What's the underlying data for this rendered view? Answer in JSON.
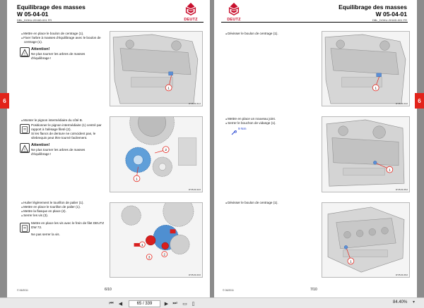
{
  "left_page": {
    "title": "Equilibrage des masses",
    "code": "W 05-04-01",
    "doc_ref": "DBL_DOKU-2016D-001 FR",
    "logo": "DEUTZ",
    "tab": "6",
    "step1": {
      "bullets": [
        "Mettre en place le boulon de centrage (1).",
        "Fixer l'arbre à masses d'équilibrage avec le boulon de centrage (1)."
      ],
      "attention_title": "Attention!",
      "attention_text": "Ne plus tourner les arbres de masses d'équilibrage !",
      "img_ref": "W 05-04-31-0"
    },
    "step2": {
      "bullets": [
        "Monter le pignon intermédiaire du côté B."
      ],
      "sub1": "Positionner le pignon intermédiaire (1) centré par rapport à l'alésage fileté (2).",
      "sub2": "Si les flancs de denture ne coïncident pas, le vilebrequin peut être tourné facilement.",
      "attention_title": "Attention!",
      "attention_text": "Ne plus tourner les arbres de masses d'équilibrage !",
      "img_ref": "W 05-04-32-0"
    },
    "step3": {
      "bullets": [
        "Huiler légèrement le tourillon de palier (1).",
        "Mettre en place le tourillon de palier (1).",
        "Mettre la flasque en place (2).",
        "Serrer les vis (3)."
      ],
      "sub1": "Mettre en place les vis avec le frein de filet DEUTZ DW 72.",
      "sub2": "Ne pas serrer la vis.",
      "img_ref": "W 05-04-33-0"
    },
    "footer": "© 06/2011",
    "page": "6/10"
  },
  "right_page": {
    "title": "Equilibrage des masses",
    "code": "W 05-04-01",
    "doc_ref": "DBL_DOKU-2016D-001 FR",
    "logo": "DEUTZ",
    "tab": "6",
    "step1": {
      "bullets": [
        "Dévisser le boulon de centrage (1)."
      ],
      "img_ref": "W 05-04-34-0"
    },
    "step2": {
      "bullets": [
        "Mettre en place un nouveau joint.",
        "Serrer le bouchon de vidange (1)."
      ],
      "torque": "9 Nm",
      "img_ref": "W 05-04-35-0"
    },
    "step3": {
      "bullets": [
        "Dévisser le boulon de centrage (1)."
      ],
      "img_ref": "W 05-04-36-0"
    },
    "footer": "© 06/2011",
    "page": "7/10"
  },
  "toolbar": {
    "page_indicator": "65 / 339",
    "zoom": "84.40%"
  },
  "colors": {
    "accent_red": "#e2231a",
    "torque_blue": "#1f3fd0"
  }
}
